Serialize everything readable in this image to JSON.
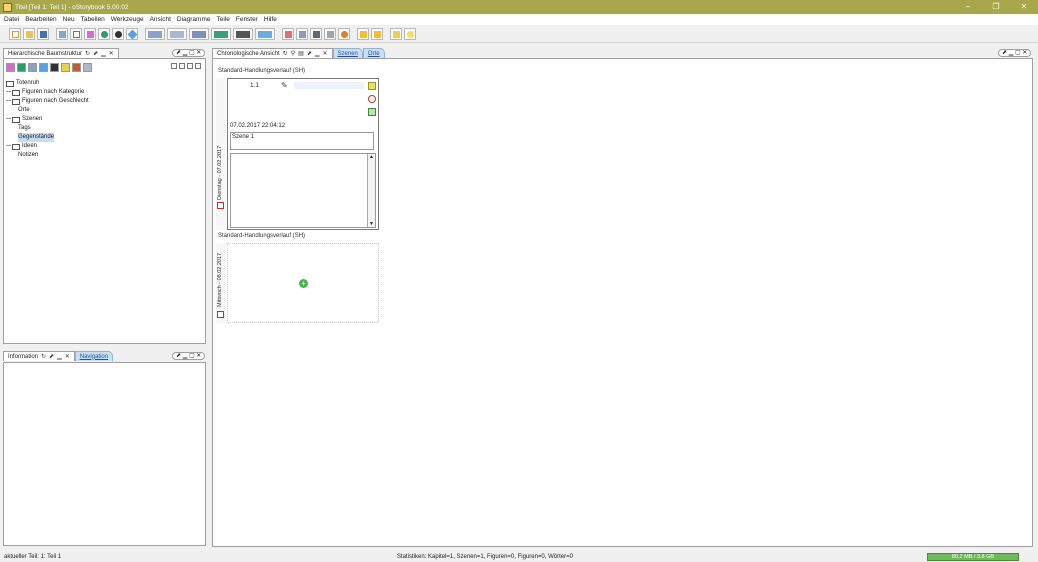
{
  "window": {
    "title": "Titel [Teil 1: Teil 1] - oStorybook 5.00.02",
    "controls": [
      "–",
      "❐",
      "✕"
    ]
  },
  "menu": [
    "Datei",
    "Bearbeiten",
    "Neu",
    "Tabellen",
    "Werkzeuge",
    "Ansicht",
    "Diagramme",
    "Teile",
    "Fenster",
    "Hilfe"
  ],
  "toolbar": {
    "icons": [
      "new-file-icon",
      "open-file-icon",
      "save-icon",
      "chapters-icon",
      "scenes-icon",
      "persons-icon",
      "locations-icon",
      "items-icon",
      "tags-icon",
      "table-icon",
      "table2-icon",
      "chart-icon",
      "chart2-icon",
      "chart3-icon",
      "chart4-icon",
      "memo-icon",
      "book-icon",
      "list-icon",
      "export-icon",
      "web-icon",
      "prev-icon",
      "next-icon",
      "idea-icon",
      "lightbulb-icon"
    ]
  },
  "tree_panel": {
    "tab_label": "Hierarchische Baumstruktur",
    "root": "Totenruh",
    "items": [
      {
        "label": "Figuren nach Kategorie",
        "folder": true,
        "expandable": true
      },
      {
        "label": "Figuren nach Geschlecht",
        "folder": true,
        "expandable": true
      },
      {
        "label": "Orte",
        "folder": false,
        "expandable": false
      },
      {
        "label": "Szenen",
        "folder": true,
        "expandable": true
      },
      {
        "label": "Tags",
        "folder": false,
        "expandable": false
      },
      {
        "label": "Gegenstände",
        "folder": false,
        "expandable": false,
        "selected": true
      },
      {
        "label": "Ideen",
        "folder": true,
        "expandable": true
      },
      {
        "label": "Notizen",
        "folder": false,
        "expandable": false
      }
    ]
  },
  "info_panel": {
    "tab_label": "Information",
    "tab2_label": "Navigation"
  },
  "main_panel": {
    "tab_label": "Chronologische Ansicht",
    "tab2_label": "Szenen",
    "tab3_label": "Orte",
    "blocks": [
      {
        "strand": "Standard-Handlungsverlauf (SH)",
        "day": "Dienstag - 07.02.2017",
        "scene_no": "1.1",
        "date": "07.02.2017 22:04:12",
        "scene_title": "Szene 1"
      },
      {
        "strand": "Standard-Handlungsverlauf (SH)",
        "day": "Mittwoch - 08.02.2017"
      }
    ]
  },
  "status": {
    "left": "aktueller Teil: 1: Teil 1",
    "stats": "Statistiken: Kapitel=1, Szenen=1, Figuren=0, Figuren=0, Wörter=0",
    "memory": "80.2 MB / 3.8 GB"
  }
}
